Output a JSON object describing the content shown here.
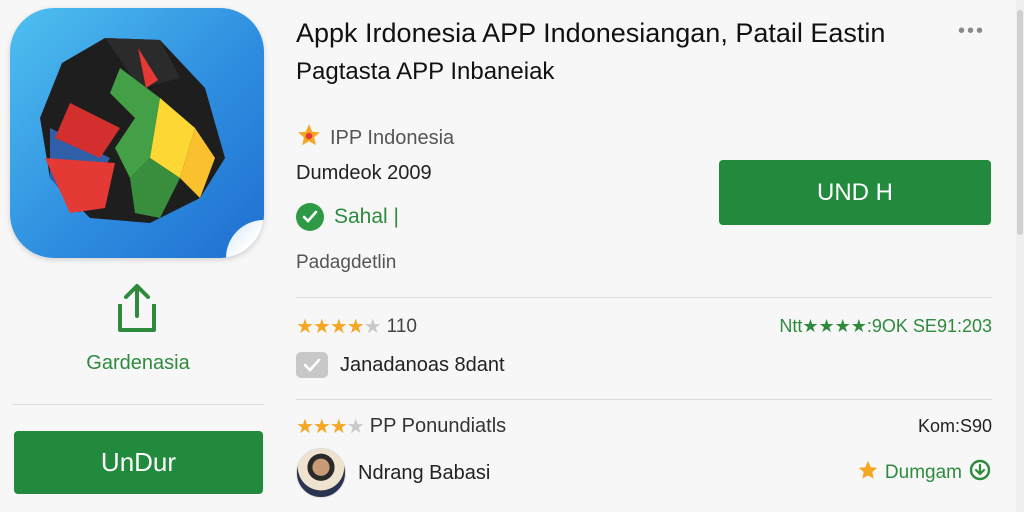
{
  "app": {
    "title_line1": "Appk Irdonesia APP Indonesiangan, Patail Eastin",
    "title_line2": "Pagtasta APP Inbaneiak",
    "developer": "IPP Indonesia",
    "date": "Dumdeok 2009",
    "status": "Sahal |",
    "category": "Padagdetlin",
    "install_button": "UND H"
  },
  "left_panel": {
    "share_label": "Gardenasia",
    "button_label": "UnDur"
  },
  "stats": {
    "rating_count": "110",
    "rating_stars": 4,
    "right_text": "Ntt★★★★:9OK  SE91:203"
  },
  "feature": {
    "label": "Janadanoas 8dant"
  },
  "review": {
    "stars": 3,
    "label": "PP Ponundiatls",
    "size": "Kom:S90",
    "author": "Ndrang Babasi",
    "download_label": "Dumgam"
  },
  "colors": {
    "accent_green": "#218a3c",
    "star": "#f5a623",
    "icon_bg": "#2f8ee0"
  },
  "icons": [
    "more-icon",
    "star-icon",
    "check-circle-icon",
    "share-icon",
    "checkbox-icon",
    "download-icon"
  ]
}
